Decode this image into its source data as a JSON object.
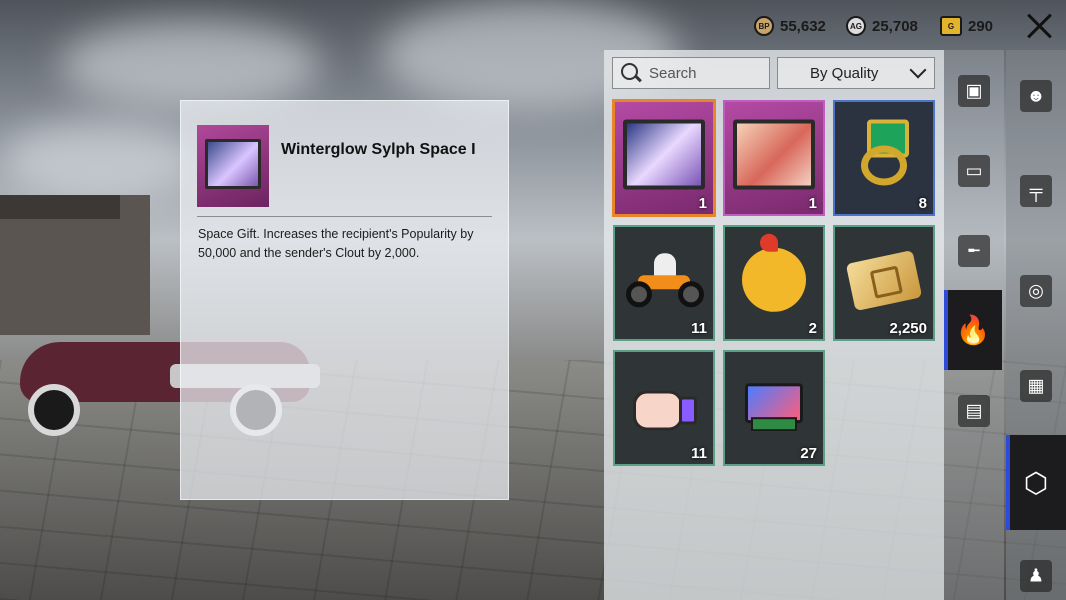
{
  "currencies": {
    "bp": {
      "icon": "bp-coin-icon",
      "value": "55,632"
    },
    "ag": {
      "icon": "ag-coin-icon",
      "value": "25,708"
    },
    "uc": {
      "icon": "uc-coin-icon",
      "value": "290"
    }
  },
  "detail": {
    "item_name": "Winterglow Sylph Space I",
    "description": "Space Gift. Increases the recipient's Popularity by 50,000 and the sender's Clout by 2,000."
  },
  "inventory": {
    "search_placeholder": "Search",
    "sort_label": "By Quality",
    "items": [
      {
        "icon": "space-gift-film-icon",
        "qty": "1",
        "quality": "purple"
      },
      {
        "icon": "space-gift-film-icon",
        "qty": "1",
        "quality": "purple"
      },
      {
        "icon": "emerald-ring-icon",
        "qty": "8",
        "quality": "blue"
      },
      {
        "icon": "motorbike-sticker-icon",
        "qty": "11",
        "quality": "green"
      },
      {
        "icon": "chicken-sticker-icon",
        "qty": "2",
        "quality": "green"
      },
      {
        "icon": "home-coupon-icon",
        "qty": "2,250",
        "quality": "green"
      },
      {
        "icon": "thumbs-up-icon",
        "qty": "11",
        "quality": "green"
      },
      {
        "icon": "royale-pass-crate-icon",
        "qty": "27",
        "quality": "green"
      }
    ]
  },
  "colors": {
    "selected_border": "#e8852b",
    "active_tab_bar": "#2d4ad8",
    "green_border": "#5aa084",
    "blue_border": "#4f73c9",
    "purple_border": "#c05dc0"
  }
}
